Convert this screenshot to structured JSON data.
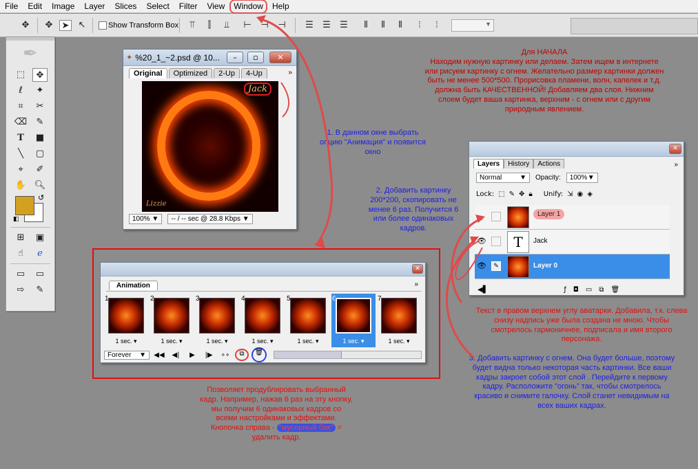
{
  "menu": [
    "File",
    "Edit",
    "Image",
    "Layer",
    "Slices",
    "Select",
    "Filter",
    "View",
    "Window",
    "Help"
  ],
  "options_bar": {
    "show_transform_label": "Show Transform Box"
  },
  "doc_window": {
    "title": "%20_1_~2.psd @ 10...",
    "tabs": [
      "Original",
      "Optimized",
      "2-Up",
      "4-Up"
    ],
    "signature_top": "Jack",
    "signature_bottom": "Lizzie",
    "zoom": "100%",
    "status": "-- / -- sec @ 28.8 Kbps"
  },
  "animation": {
    "tab": "Animation",
    "frames": [
      {
        "num": "1",
        "time": "1 sec."
      },
      {
        "num": "2",
        "time": "1 sec."
      },
      {
        "num": "3",
        "time": "1 sec."
      },
      {
        "num": "4",
        "time": "1 sec."
      },
      {
        "num": "5",
        "time": "1 sec."
      },
      {
        "num": "6",
        "time": "1 sec."
      },
      {
        "num": "7",
        "time": "1 sec."
      }
    ],
    "selected_frame": 6,
    "loop": "Forever"
  },
  "layers_window": {
    "tabs": [
      "Layers",
      "History",
      "Actions"
    ],
    "blend_mode": "Normal",
    "opacity_label": "Opacity:",
    "opacity_value": "100%",
    "lock_label": "Lock:",
    "unify_label": "Unify:",
    "layers": [
      {
        "name": "Layer 1",
        "thumb": "fire",
        "visible": false,
        "selected": false
      },
      {
        "name": "Jack",
        "thumb": "text",
        "visible": true,
        "selected": false
      },
      {
        "name": "Layer 0",
        "thumb": "fire",
        "visible": true,
        "selected": true
      }
    ]
  },
  "notes": {
    "intro": "Для НАЧАЛА\nНаходим нужную картинку или делаем. Затем ищем в интернете или рисуем картинку с огнем. Желательно размер картинки должен быть не менее 500*500. Прорисовка пламени, волн, капелек и т.д. должна быть КАЧЕСТВЕННОЙ! Добавляем два слоя. Нижним слоем будет ваша картинка, верхним - с огнем или с другим природным явлением.",
    "step1": "1. В данном окне выбрать опцию \"Анимация\" и появится окно",
    "step2": "2. Добавить картинку 200*200, скопировать не менее 6 раз. Получится 6 или более одинаковых кадров.",
    "text_note": "Текст в правом верхнем углу аватарки. Добавила, т.к. слева снизу надпись уже была создана не мною. Чтобы смотрелось гармоничнее, подписала и имя второго персонажа.",
    "step3": "3. Добавить картинку с огнем. Она будет больше, поэтому будет видна только некоторая часть картинки. Все ваши кадры закроет собой этот слой . Перейдите к первому кадру. Расположите \"огонь\" так, чтобы смотрелось красиво и снимите галочку. Слой станет невидимым на всех ваших кадрах.",
    "dup_note": "Позволяет продублировать выбранный кадр. Например, нажав 6 раз на эту кнопку, мы получим 6 одинаковых кадров со всеми настройками и эффектами.",
    "trash_prefix": "Кнопочка справа - ",
    "trash_hl": "\"мусорный бак\"",
    "trash_suffix": " = удалить кадр."
  },
  "colors": {
    "accent_red": "#e01010",
    "accent_blue": "#2020e0",
    "selection_blue": "#3a8ee8",
    "foreground": "#d4a020"
  }
}
